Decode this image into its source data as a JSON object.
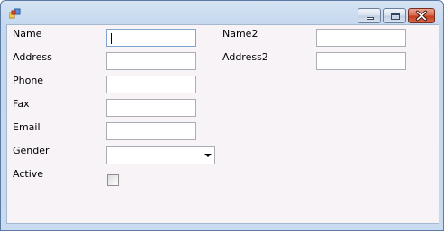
{
  "window": {
    "title": "",
    "icon": "app-icon",
    "caption_buttons": [
      "minimize-icon",
      "maximize-icon",
      "close-icon"
    ]
  },
  "form": {
    "name_label": "Name",
    "name_value": "",
    "address_label": "Address",
    "address_value": "",
    "phone_label": "Phone",
    "phone_value": "",
    "fax_label": "Fax",
    "fax_value": "",
    "email_label": "Email",
    "email_value": "",
    "gender_label": "Gender",
    "gender_value": "",
    "active_label": "Active",
    "active_checked": false,
    "name2_label": "Name2",
    "name2_value": "",
    "address2_label": "Address2",
    "address2_value": ""
  },
  "colors": {
    "client_background": "#f7f3f7",
    "close_button": "#c43a1c",
    "frame": "#c4d7ee"
  }
}
